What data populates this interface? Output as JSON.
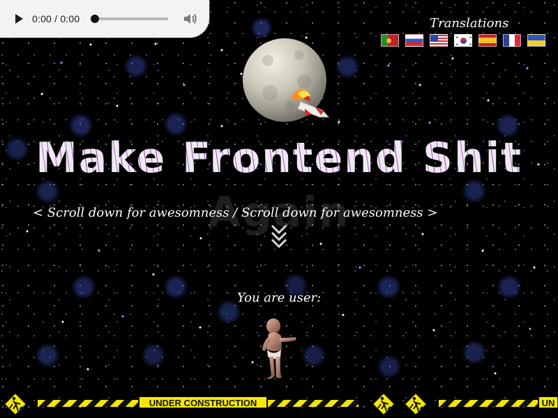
{
  "audio_player": {
    "time": "0:00 / 0:00",
    "progress": 0,
    "play_icon": "play-icon",
    "volume_icon": "volume-icon"
  },
  "translations": {
    "title": "Translations",
    "flags": [
      "portugal-flag",
      "russia-flag",
      "usa-flag",
      "south-korea-flag",
      "spain-flag",
      "france-flag",
      "ukraine-flag"
    ]
  },
  "hero": {
    "title": "Make Frontend Shit Again",
    "scroll_hint": "< Scroll down for awesomness / Scroll down for awesomness >",
    "scroll_icon": "double-chevron-down-icon"
  },
  "user": {
    "label": "You are user:",
    "icon": "dancing-baby-image"
  },
  "construction": {
    "label_primary": "UNDER CONSTRUCTION",
    "label_secondary": "UN",
    "warning_icon": "worker-warning-icon"
  },
  "colors": {
    "background": "#000000",
    "player_background": "#f2f3f4",
    "title_fill": "#ebe8ef",
    "title_speckle": "#8d2ea0",
    "construction_yellow": "#f3e600"
  }
}
